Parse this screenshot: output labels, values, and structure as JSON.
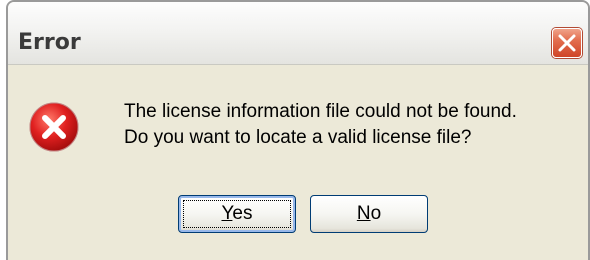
{
  "dialog": {
    "title": "Error",
    "message_line1": "The license information file could not be found.",
    "message_line2": "Do you want to locate a valid license file?",
    "icon": "error-icon"
  },
  "buttons": {
    "yes_accel": "Y",
    "yes_rest": "es",
    "no_accel": "N",
    "no_rest": "o"
  },
  "colors": {
    "dialog_bg": "#ece9d8",
    "close_button": "#e36e4f",
    "error_icon": "#e02020",
    "button_border": "#003c74"
  }
}
